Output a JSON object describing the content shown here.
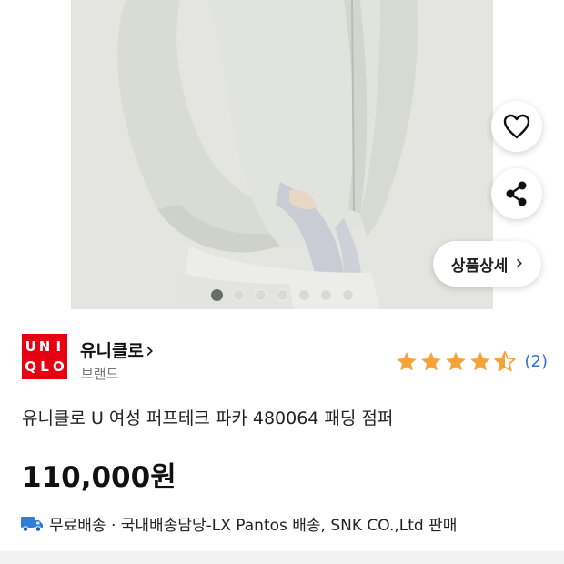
{
  "product_image": {
    "alt": "유니클로 U 여성 퍼프테크 파카",
    "slide_count": 7,
    "active_slide": 1
  },
  "actions": {
    "wishlist_icon": "heart-icon",
    "share_icon": "share-icon",
    "detail_label": "상품상세",
    "detail_chevron": "›"
  },
  "brand": {
    "logo_letters": [
      "U",
      "N",
      "I",
      "Q",
      "L",
      "O"
    ],
    "name": "유니클로",
    "chevron": "›",
    "sub_label": "브랜드",
    "logo_color": "#e60012"
  },
  "rating": {
    "stars": 4.5,
    "max": 5,
    "count_label": "(2)",
    "star_color": "#f4a23a",
    "count_color": "#3b6fd8"
  },
  "product": {
    "title": "유니클로 U 여성 퍼프테크 파카 480064 패딩 점퍼",
    "price": "110,000원"
  },
  "shipping": {
    "icon": "truck-icon",
    "text": "무료배송 · 국내배송담당-LX Pantos 배송, SNK CO.,Ltd 판매"
  }
}
